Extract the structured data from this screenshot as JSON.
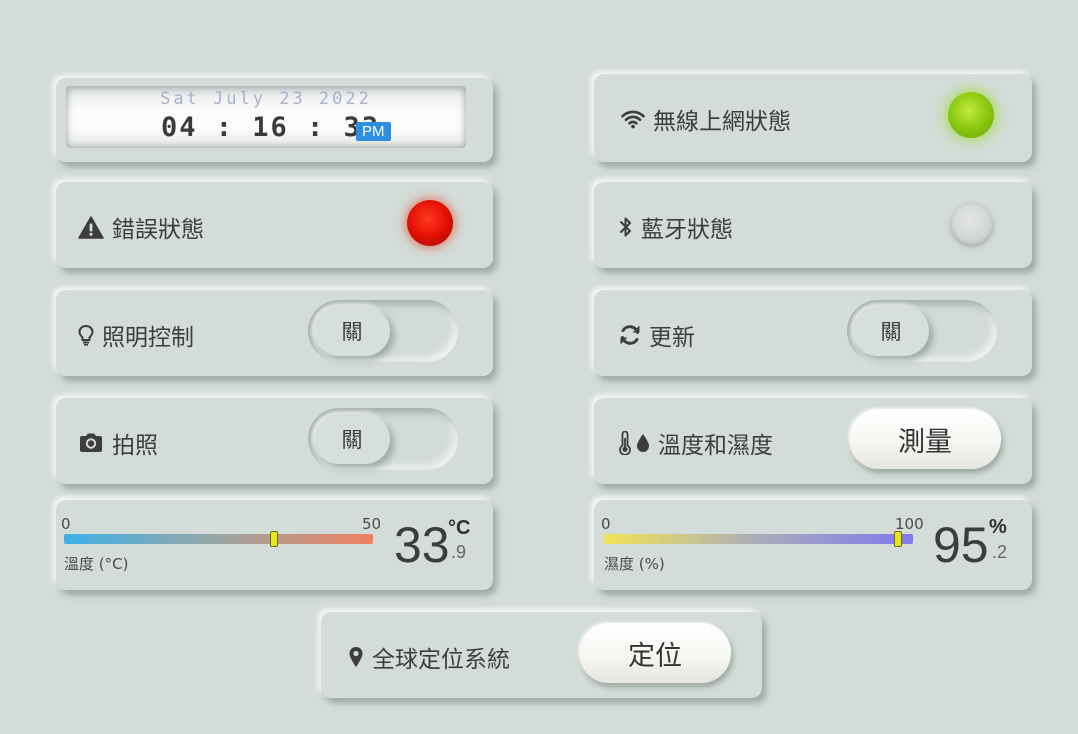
{
  "clock": {
    "date": "Sat  July 23  2022",
    "time": "04 : 16 : 33",
    "ampm": "PM"
  },
  "wifi": {
    "label": "無線上網狀態",
    "icon": "wifi-icon",
    "led_state": "on",
    "led_color": "#8fcb12"
  },
  "error": {
    "label": "錯誤狀態",
    "icon": "warning-icon",
    "led_state": "on",
    "led_color": "#e21004"
  },
  "bluetooth": {
    "label": "藍牙狀態",
    "icon": "bluetooth-icon",
    "led_state": "off"
  },
  "lighting": {
    "label": "照明控制",
    "icon": "lightbulb-icon",
    "toggle_label": "關",
    "toggle_on": false
  },
  "refresh": {
    "label": "更新",
    "icon": "refresh-icon",
    "toggle_label": "關",
    "toggle_on": false
  },
  "camera": {
    "label": "拍照",
    "icon": "camera-icon",
    "toggle_label": "關",
    "toggle_on": false
  },
  "temp_humidity": {
    "label": "溫度和濕度",
    "icons": [
      "thermometer-icon",
      "droplet-icon"
    ],
    "button_label": "測量"
  },
  "temperature_gauge": {
    "min_label": "0",
    "max_label": "50",
    "min": 0,
    "max": 50,
    "value": 33.9,
    "caption": "溫度 (°C)",
    "value_int": "33",
    "value_dec": ".9",
    "unit": "°C",
    "gradient": [
      "#3fb0e8",
      "#9aa6a3",
      "#f07f5f"
    ]
  },
  "humidity_gauge": {
    "min_label": "0",
    "max_label": "100",
    "min": 0,
    "max": 100,
    "value": 95.2,
    "caption": "濕度 (%)",
    "value_int": "95",
    "value_dec": ".2",
    "unit": "%",
    "gradient": [
      "#f2e35a",
      "#a9acb8",
      "#7f79ee"
    ]
  },
  "gps": {
    "label": "全球定位系統",
    "icon": "map-pin-icon",
    "button_label": "定位"
  }
}
